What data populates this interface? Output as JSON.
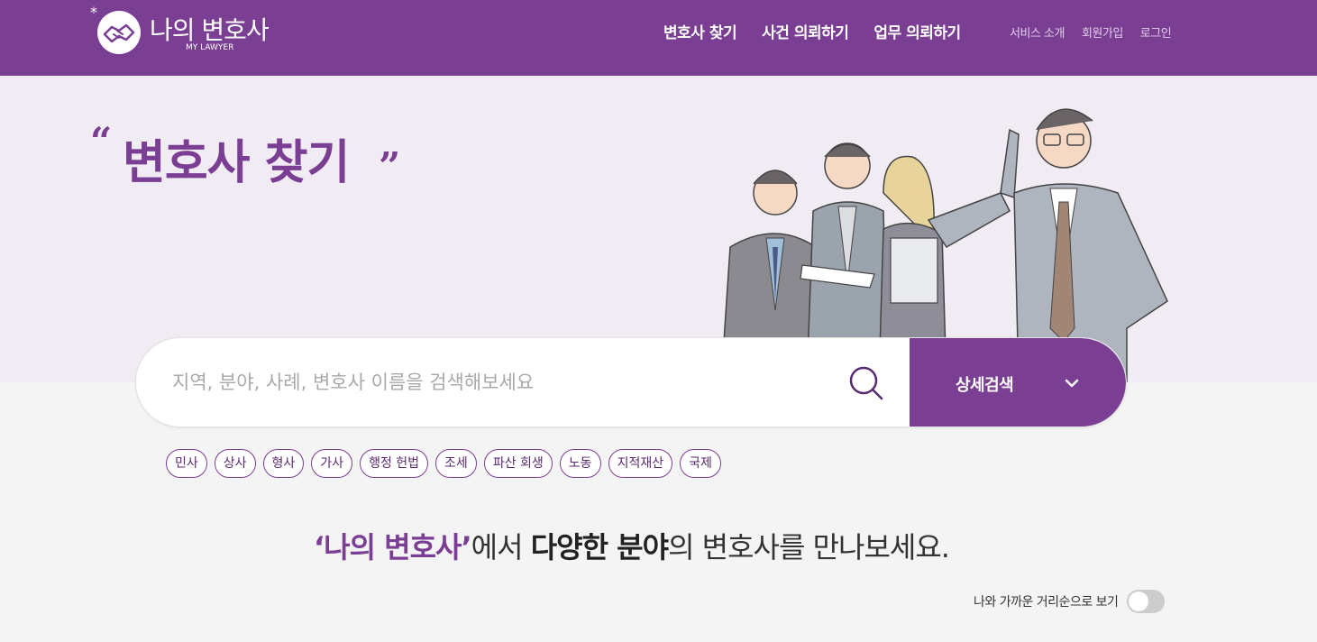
{
  "header": {
    "logo_title": "나의 변호사",
    "logo_sub": "MY LAWYER",
    "nav": [
      "변호사 찾기",
      "사건 의뢰하기",
      "업무 의뢰하기"
    ],
    "util": [
      "서비스 소개",
      "회원가입",
      "로그인"
    ]
  },
  "hero": {
    "title": "변호사 찾기",
    "illustration": "group-of-lawyers-illustration"
  },
  "search": {
    "placeholder": "지역, 분야, 사례, 변호사 이름을 검색해보세요",
    "detail_label": "상세검색"
  },
  "tags": [
    "민사",
    "상사",
    "형사",
    "가사",
    "행정 헌법",
    "조세",
    "파산 회생",
    "노동",
    "지적재산",
    "국제"
  ],
  "tagline": {
    "brand": "‘나의 변호사’",
    "part1": "에서 ",
    "strong": "다양한 분야",
    "part2": "의 변호사를 만나보세요."
  },
  "toggle": {
    "label": "나와 가까운 거리순으로 보기",
    "on": false
  },
  "colors": {
    "brand": "#7a3e93",
    "hero_bg": "#f1ebf4",
    "page_bg": "#f4f4f4"
  }
}
